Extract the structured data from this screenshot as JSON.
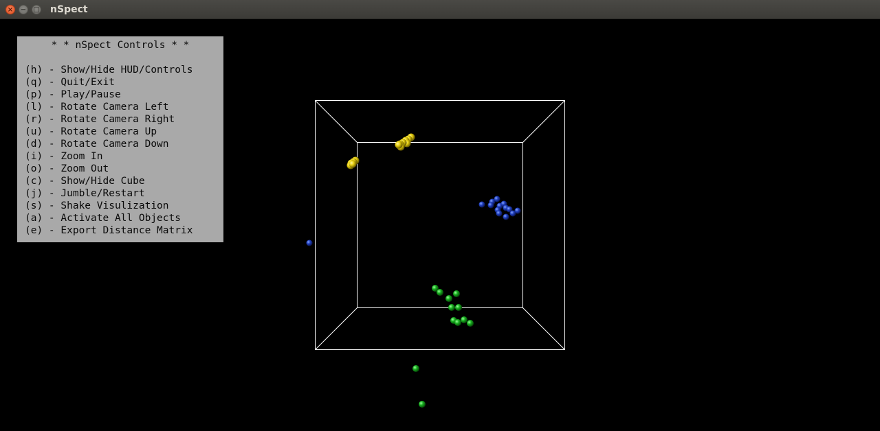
{
  "window": {
    "title": "nSpect",
    "close_glyph": "×",
    "minimize_glyph": "−",
    "maximize_glyph": "□"
  },
  "hud": {
    "title": "* * nSpect Controls * *",
    "items": [
      "(h) - Show/Hide HUD/Controls",
      "(q) - Quit/Exit",
      "(p) - Play/Pause",
      "(l) - Rotate Camera Left",
      "(r) - Rotate Camera Right",
      "(u) - Rotate Camera Up",
      "(d) - Rotate Camera Down",
      "(i) - Zoom In",
      "(o) - Zoom Out",
      "(c) - Show/Hide Cube",
      "(j) - Jumble/Restart",
      "(s) - Shake Visulization",
      "(a) - Activate All Objects",
      "(e) - Export Distance Matrix"
    ]
  },
  "scene": {
    "background": "#000000",
    "cube_color": "#ffffff",
    "cluster_colors": {
      "yellow": "#e8d010",
      "blue": "#2040c0",
      "green": "#18b020"
    }
  }
}
